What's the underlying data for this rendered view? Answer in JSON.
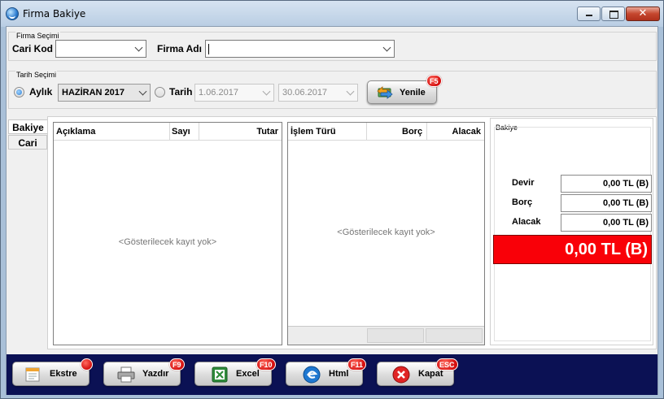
{
  "window": {
    "title": "Firma Bakiye"
  },
  "firma": {
    "group_label": "Firma Seçimi",
    "cari_kod_label": "Cari Kod",
    "cari_kod_value": "",
    "firma_adi_label": "Firma Adı",
    "firma_adi_value": ""
  },
  "tarih": {
    "group_label": "Tarih Seçimi",
    "aylik_label": "Aylık",
    "aylik_selected": true,
    "month_value": "HAZİRAN 2017",
    "tarih_label": "Tarih",
    "start_date": "1.06.2017",
    "end_date": "30.06.2017",
    "refresh_label": "Yenile",
    "refresh_key": "F5"
  },
  "tabs": [
    {
      "label": "Bakiye",
      "active": true
    },
    {
      "label": "Cari",
      "active": false
    }
  ],
  "summary_grid": {
    "columns": [
      "Açıklama",
      "Sayı",
      "Tutar"
    ],
    "empty_text": "<Gösterilecek kayıt yok>"
  },
  "transaction_grid": {
    "columns": [
      "İşlem Türü",
      "Borç",
      "Alacak"
    ],
    "empty_text": "<Gösterilecek kayıt yok>"
  },
  "balance": {
    "panel_label": "Bakiye",
    "rows": [
      {
        "label": "Devir",
        "value": "0,00 TL (B)"
      },
      {
        "label": "Borç",
        "value": "0,00 TL (B)"
      },
      {
        "label": "Alacak",
        "value": "0,00 TL (B)"
      }
    ],
    "total": "0,00 TL (B)",
    "total_color": "#f90008"
  },
  "actions": [
    {
      "label": "Ekstre",
      "key": ""
    },
    {
      "label": "Yazdır",
      "key": "F9"
    },
    {
      "label": "Excel",
      "key": "F10"
    },
    {
      "label": "Html",
      "key": "F11"
    },
    {
      "label": "Kapat",
      "key": "ESC"
    }
  ]
}
